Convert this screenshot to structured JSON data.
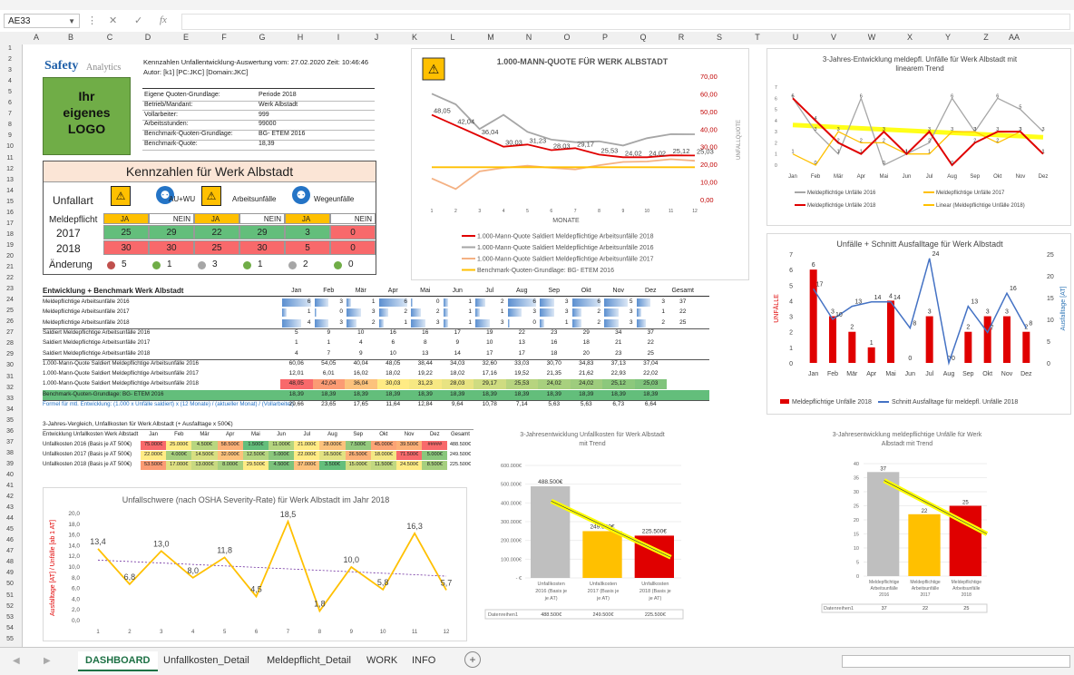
{
  "namebox": "AE33",
  "fx": "fx",
  "columns": [
    "A",
    "B",
    "C",
    "D",
    "E",
    "F",
    "G",
    "H",
    "I",
    "J",
    "K",
    "L",
    "M",
    "N",
    "O",
    "P",
    "Q",
    "R",
    "S",
    "T",
    "U",
    "V",
    "W",
    "X",
    "Y",
    "Z",
    "AA"
  ],
  "rows": [
    "1",
    "2",
    "3",
    "4",
    "5",
    "6",
    "7",
    "8",
    "9",
    "10",
    "11",
    "12",
    "13",
    "14",
    "15",
    "16",
    "17",
    "18",
    "19",
    "20",
    "21",
    "22",
    "23",
    "24",
    "25",
    "26",
    "27",
    "28",
    "29",
    "30",
    "31",
    "32",
    "33",
    "34",
    "35",
    "36",
    "37",
    "38",
    "39",
    "40",
    "41",
    "42",
    "43",
    "44",
    "45",
    "46",
    "47",
    "48",
    "49",
    "50",
    "51",
    "52",
    "53",
    "54",
    "55"
  ],
  "logo": {
    "brand1": "Safety",
    "brand2": "Analytics",
    "box_lines": [
      "Ihr",
      "eigenes",
      "LOGO"
    ]
  },
  "header": {
    "line1": "Kennzahlen Unfallentwicklung-Auswertung vom: 27.02.2020 Zeit: 10:46:46",
    "line2": "Autor: [k1] [PC:JKC] [Domain:JKC]"
  },
  "info": [
    [
      "Eigene Quoten-Grundlage:",
      "Periode 2018"
    ],
    [
      "Betrieb/Mandant:",
      "Werk Albstadt"
    ],
    [
      "Vollarbeiter:",
      "999"
    ],
    [
      "Arbeitsstunden:",
      "99000"
    ],
    [
      "Benchmark-Quoten-Grundlage:",
      "BG- ETEM 2016"
    ],
    [
      "Benchmark-Quote:",
      "18,39"
    ]
  ],
  "kennzahlen": {
    "title": "Kennzahlen für Werk Albstadt",
    "unfallart": "Unfallart",
    "meldepflicht": "Meldepflicht",
    "cats": [
      "AU+WU",
      "Arbeitsunfälle",
      "Wegeunfälle"
    ],
    "ja": "JA",
    "nein": "NEIN",
    "rows": [
      {
        "label": "2017",
        "vals": [
          "25",
          "29",
          "22",
          "29",
          "3",
          "0"
        ]
      },
      {
        "label": "2018",
        "vals": [
          "30",
          "30",
          "25",
          "30",
          "5",
          "0"
        ]
      }
    ],
    "aenderung": "Änderung",
    "changes": [
      "5",
      "1",
      "3",
      "1",
      "2",
      "0"
    ]
  },
  "entw": {
    "title": "Entwicklung + Benchmark Werk Albstadt",
    "months": [
      "Jan",
      "Feb",
      "Mär",
      "Apr",
      "Mai",
      "Jun",
      "Jul",
      "Aug",
      "Sep",
      "Okt",
      "Nov",
      "Dez",
      "Gesamt"
    ],
    "rows": [
      {
        "label": "Meldepflichtige Arbeitsunfälle 2016",
        "vals": [
          "6",
          "3",
          "1",
          "6",
          "0",
          "1",
          "2",
          "6",
          "3",
          "6",
          "5",
          "3",
          "37"
        ]
      },
      {
        "label": "Meldepflichtige Arbeitsunfälle 2017",
        "vals": [
          "1",
          "0",
          "3",
          "2",
          "2",
          "1",
          "1",
          "3",
          "3",
          "2",
          "3",
          "1",
          "22"
        ]
      },
      {
        "label": "Meldepflichtige Arbeitsunfälle 2018",
        "vals": [
          "4",
          "3",
          "2",
          "1",
          "3",
          "1",
          "3",
          "0",
          "1",
          "2",
          "3",
          "2",
          "25"
        ]
      },
      {
        "label": "Saldiert Meldepflichtige Arbeitsunfälle 2016",
        "vals": [
          "5",
          "9",
          "10",
          "16",
          "16",
          "17",
          "19",
          "22",
          "23",
          "29",
          "34",
          "37",
          ""
        ]
      },
      {
        "label": "Saldiert Meldepflichtige Arbeitsunfälle 2017",
        "vals": [
          "1",
          "1",
          "4",
          "6",
          "8",
          "9",
          "10",
          "13",
          "16",
          "18",
          "21",
          "22",
          ""
        ]
      },
      {
        "label": "Saldiert Meldepflichtige Arbeitsunfälle 2018",
        "vals": [
          "4",
          "7",
          "9",
          "10",
          "13",
          "14",
          "17",
          "17",
          "18",
          "20",
          "23",
          "25",
          ""
        ]
      },
      {
        "label": "1.000-Mann-Quote Saldiert Meldepflichtige Arbeitsunfälle 2016",
        "vals": [
          "60,06",
          "54,05",
          "40,04",
          "48,05",
          "38,44",
          "34,03",
          "32,60",
          "33,03",
          "30,70",
          "34,83",
          "37,13",
          "37,04",
          ""
        ]
      },
      {
        "label": "1.000-Mann-Quote Saldiert Meldepflichtige Arbeitsunfälle 2017",
        "vals": [
          "12,01",
          "6,01",
          "16,02",
          "18,02",
          "19,22",
          "18,02",
          "17,16",
          "19,52",
          "21,35",
          "21,62",
          "22,93",
          "22,02",
          ""
        ]
      },
      {
        "label": "1.000-Mann-Quote Saldiert Meldepflichtige Arbeitsunfälle 2018",
        "vals": [
          "48,05",
          "42,04",
          "36,04",
          "30,03",
          "31,23",
          "28,03",
          "29,17",
          "25,53",
          "24,02",
          "24,02",
          "25,12",
          "25,03",
          ""
        ]
      },
      {
        "label": "Benchmark-Quoten-Grundlage: BG- ETEM 2016",
        "vals": [
          "18,39",
          "18,39",
          "18,39",
          "18,39",
          "18,39",
          "18,39",
          "18,39",
          "18,39",
          "18,39",
          "18,39",
          "18,39",
          "18,39",
          ""
        ]
      },
      {
        "label": "Formel für mtl. Entwicklung: (1.000 x Unfälle saldiert) x (12 Monate) / (aktueller Monat) / (Vollarbeiter)",
        "vals": [
          "29,66",
          "23,65",
          "17,65",
          "11,64",
          "12,84",
          "9,64",
          "10,78",
          "7,14",
          "5,63",
          "5,63",
          "6,73",
          "6,64",
          ""
        ]
      }
    ]
  },
  "kosten": {
    "title": "3-Jahres-Vergleich, Unfallkosten für Werk Albstadt (+ Ausfalltage x 500€)",
    "header": "Entwicklung Unfallkosten Werk Albstadt",
    "months": [
      "Jan",
      "Feb",
      "Mär",
      "Apr",
      "Mai",
      "Jun",
      "Jul",
      "Aug",
      "Sep",
      "Okt",
      "Nov",
      "Dez",
      "Gesamt"
    ],
    "rows": [
      {
        "label": "Unfallkosten 2016 (Basis je AT 500€)",
        "vals": [
          "75.000€",
          "25.000€",
          "4.500€",
          "58.500€",
          "1.500€",
          "11.000€",
          "21.000€",
          "28.000€",
          "7.500€",
          "45.000€",
          "39.500€",
          "#####",
          "488.500€"
        ]
      },
      {
        "label": "Unfallkosten 2017 (Basis je AT 500€)",
        "vals": [
          "22.000€",
          "4.000€",
          "14.500€",
          "32.000€",
          "12.500€",
          "5.000€",
          "22.000€",
          "16.500€",
          "26.500€",
          "18.000€",
          "71.500€",
          "5.000€",
          "249.500€"
        ]
      },
      {
        "label": "Unfallkosten 2018 (Basis je AT 500€)",
        "vals": [
          "53.500€",
          "17.000€",
          "13.000€",
          "8.000€",
          "29.500€",
          "4.500€",
          "37.000€",
          "3.500€",
          "15.000€",
          "11.500€",
          "24.500€",
          "8.500€",
          "225.500€"
        ]
      }
    ]
  },
  "chart_data": [
    {
      "type": "line",
      "title": "1.000-MANN-QUOTE FÜR WERK ALBSTADT",
      "xlabel": "MONATE",
      "ylabel": "UNFALLQUOTE",
      "x": [
        "1",
        "2",
        "3",
        "4",
        "5",
        "6",
        "7",
        "8",
        "9",
        "10",
        "11",
        "12"
      ],
      "ylim": [
        0,
        70
      ],
      "yticks": [
        "0,00",
        "10,00",
        "20,00",
        "30,00",
        "40,00",
        "50,00",
        "60,00",
        "70,00"
      ],
      "series": [
        {
          "name": "1.000-Mann-Quote Saldiert Meldepflichtige Arbeitsunfälle 2018",
          "color": "#e00000",
          "values": [
            48.05,
            42.04,
            36.04,
            30.03,
            31.23,
            28.03,
            29.17,
            25.53,
            24.02,
            24.02,
            25.12,
            25.03
          ]
        },
        {
          "name": "1.000-Mann-Quote Saldiert Meldepflichtige Arbeitsunfälle 2016",
          "color": "#a6a6a6",
          "values": [
            60.06,
            54.05,
            40.04,
            48.05,
            38.44,
            34.03,
            32.6,
            33.03,
            30.7,
            34.83,
            37.13,
            37.04
          ]
        },
        {
          "name": "1.000-Mann-Quote Saldiert Meldepflichtige Arbeitsunfälle 2017",
          "color": "#f4b183",
          "values": [
            12.01,
            6.01,
            16.02,
            18.02,
            19.22,
            18.02,
            17.16,
            19.52,
            21.35,
            21.62,
            22.93,
            22.02
          ]
        },
        {
          "name": "Benchmark-Quoten-Grundlage: BG- ETEM 2016",
          "color": "#ffc000",
          "values": [
            18.39,
            18.39,
            18.39,
            18.39,
            18.39,
            18.39,
            18.39,
            18.39,
            18.39,
            18.39,
            18.39,
            18.39
          ]
        }
      ],
      "labels": [
        "48,05",
        "42,04",
        "36,04",
        "30,03",
        "31,23",
        "28,03",
        "29,17",
        "25,53",
        "24,02",
        "24,02",
        "25,12",
        "25,03"
      ]
    },
    {
      "type": "line",
      "title": "3-Jahres-Entwicklung meldepfl. Unfälle für Werk Albstadt mit linearem Trend",
      "categories": [
        "Jan",
        "Feb",
        "Mär",
        "Apr",
        "Mai",
        "Jun",
        "Jul",
        "Aug",
        "Sep",
        "Okt",
        "Nov",
        "Dez"
      ],
      "ylim": [
        0,
        7
      ],
      "series": [
        {
          "name": "Meldepflichtige Unfälle 2016",
          "color": "#a6a6a6",
          "values": [
            6,
            3,
            1,
            6,
            0,
            1,
            2,
            6,
            3,
            6,
            5,
            3
          ]
        },
        {
          "name": "Meldepflichtige Unfälle 2017",
          "color": "#ffc000",
          "values": [
            1,
            0,
            3,
            2,
            2,
            1,
            1,
            3,
            3,
            2,
            3,
            1
          ]
        },
        {
          "name": "Meldepflichtige Unfälle 2018",
          "color": "#e00000",
          "values": [
            6,
            4,
            2,
            1,
            3,
            1,
            3,
            0,
            2,
            3,
            3,
            1
          ]
        },
        {
          "name": "Linear (Meldepflichtige Unfälle 2018)",
          "color": "#ffff00",
          "values": [
            3.6,
            3.5,
            3.4,
            3.3,
            3.2,
            3.1,
            3.0,
            2.9,
            2.8,
            2.7,
            2.6,
            2.5
          ]
        }
      ]
    },
    {
      "type": "bar",
      "title": "Unfälle + Schnitt Ausfalltage für Werk Albstadt",
      "categories": [
        "Jan",
        "Feb",
        "Mär",
        "Apr",
        "Mai",
        "Jun",
        "Jul",
        "Aug",
        "Sep",
        "Okt",
        "Nov",
        "Dez"
      ],
      "ylabel": "UNFÄLLE",
      "y2label": "Ausfalltage [AT]",
      "ylim": [
        0,
        7
      ],
      "y2lim": [
        0,
        25
      ],
      "series": [
        {
          "name": "Meldepflichtige Unfälle 2018",
          "color": "#e00000",
          "values": [
            6,
            3,
            2,
            1,
            4,
            0,
            3,
            0,
            2,
            3,
            3,
            2
          ]
        },
        {
          "name": "Schnitt Ausfalltage für meldepfl. Unfälle 2018",
          "color": "#4472c4",
          "values": [
            17,
            10,
            13,
            14,
            14,
            8,
            24,
            0,
            13,
            7,
            16,
            8
          ]
        }
      ]
    },
    {
      "type": "bar",
      "title": "3-Jahresentwicklung Unfallkosten für Werk Albstadt mit Trend",
      "categories": [
        "Unfallkosten 2016 (Basis je AT 500€)",
        "Unfallkosten 2017 (Basis je AT 500€)",
        "Unfallkosten 2018 (Basis je AT 500€)"
      ],
      "values": [
        488500,
        249500,
        225500
      ],
      "labels": [
        "488.500€",
        "249.500€",
        "225.500€"
      ],
      "colors": [
        "#bfbfbf",
        "#ffc000",
        "#e00000"
      ],
      "ylim": [
        0,
        600000
      ],
      "yticks": [
        "- €",
        "100.000€",
        "200.000€",
        "300.000€",
        "400.000€",
        "500.000€",
        "600.000€"
      ],
      "table_label": "Datenreihen1"
    },
    {
      "type": "bar",
      "title": "3-Jahresentwicklung meldepflichtige Unfälle für Werk Albstadt mit Trend",
      "categories": [
        "Meldepflichtige Arbeitsunfälle 2016",
        "Meldepflichtige Arbeitsunfälle 2017",
        "Meldepflichtige Arbeitsunfälle 2018"
      ],
      "values": [
        37,
        22,
        25
      ],
      "colors": [
        "#bfbfbf",
        "#ffc000",
        "#e00000"
      ],
      "ylim": [
        0,
        40
      ],
      "table_label": "Datenreihen1"
    },
    {
      "type": "line",
      "title": "Unfallschwere (nach OSHA Severity-Rate) für Werk Albstadt im Jahr 2018",
      "ylabel": "Ausfalltage [AT] / Unfälle [ab 1 AT]",
      "x": [
        "1",
        "2",
        "3",
        "4",
        "5",
        "6",
        "7",
        "8",
        "9",
        "10",
        "11",
        "12"
      ],
      "ylim": [
        0,
        20
      ],
      "yticks": [
        "0,0",
        "2,0",
        "4,0",
        "6,0",
        "8,0",
        "10,0",
        "12,0",
        "14,0",
        "16,0",
        "18,0",
        "20,0"
      ],
      "series": [
        {
          "name": "Severity",
          "color": "#ffc000",
          "values": [
            13.4,
            6.8,
            13.0,
            8.0,
            11.8,
            4.5,
            18.5,
            1.8,
            10.0,
            5.8,
            16.3,
            5.7
          ]
        }
      ],
      "labels": [
        "13,4",
        "6,8",
        "13,0",
        "8,0",
        "11,8",
        "4,5",
        "18,5",
        "1,8",
        "10,0",
        "5,8",
        "16,3",
        "5,7"
      ]
    }
  ],
  "tabs": [
    "DASHBOARD",
    "Unfallkosten_Detail",
    "Meldepflicht_Detail",
    "WORK",
    "INFO"
  ]
}
